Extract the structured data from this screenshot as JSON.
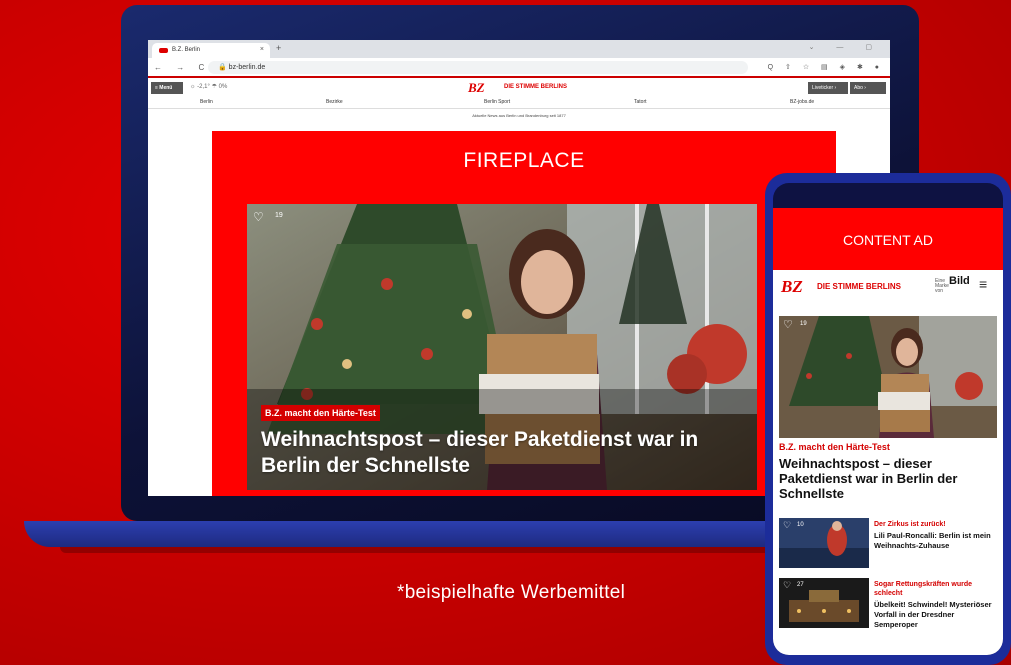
{
  "browser": {
    "tab_title": "B.Z. Berlin",
    "tab_close": "×",
    "new_tab": "+",
    "window_controls": "⌄ — ▢",
    "nav_icons": "← → C ⌂",
    "url": "bz-berlin.de",
    "lock_icon": "🔒",
    "extension_icons": "Q ⇧ ☆ ▤ ◈ ✱ ●"
  },
  "site": {
    "menu_label": "≡ Menü",
    "weather": "☼ -2,1° ☂ 0%",
    "logo": "BZ",
    "logo_sub": "DIE STIMME BERLINS",
    "btn_liveticker": "Liveticker ›",
    "btn_abo": "Abo ›",
    "nav": [
      "Berlin",
      "Bezirke",
      "Berlin Sport",
      "Tatort",
      "BZ-jobs.de"
    ],
    "tagline": "Aktuelle News aus Berlin und Brandenburg seit 1877"
  },
  "ad": {
    "fireplace_label": "FIREPLACE",
    "content_ad_label": "CONTENT AD"
  },
  "hero": {
    "like_count": "19",
    "kicker": "B.Z. macht den Härte-Test",
    "headline": "Weihnachtspost – dieser Paketdienst war in Berlin der Schnellste"
  },
  "mobile": {
    "logo": "BZ",
    "logo_sub": "DIE STIMME BERLINS",
    "bild_small": "Eine Marke von",
    "bild": "Bild",
    "menu_icon": "≡",
    "hero_like_count": "19",
    "kicker": "B.Z. macht den Härte-Test",
    "headline": "Weihnachtspost – dieser Paketdienst war in Berlin der Schnellste",
    "articles": [
      {
        "likes": "10",
        "kicker": "Der Zirkus ist zurück!",
        "headline": "Lili Paul-Roncalli: Berlin ist mein Weihnachts-Zuhause"
      },
      {
        "likes": "27",
        "kicker": "Sogar Rettungskräften wurde schlecht",
        "headline": "Übelkeit! Schwindel! Mysteriöser Vorfall in der Dresdner Semperoper"
      }
    ]
  },
  "footnote": "*beispielhafte Werbemittel"
}
